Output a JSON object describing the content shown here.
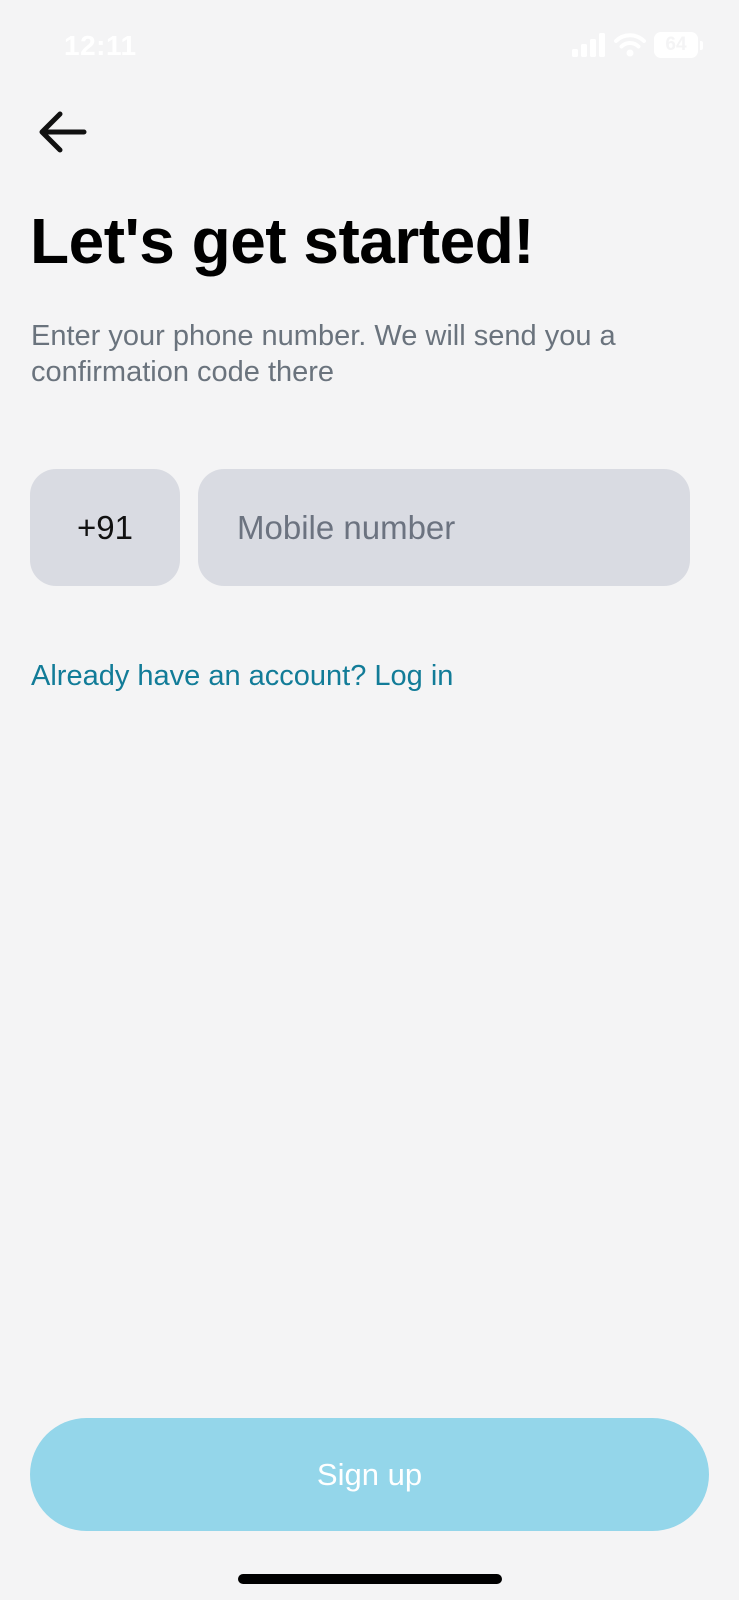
{
  "status_bar": {
    "time": "12:11",
    "battery_level": "64",
    "icons": [
      "cellular-signal-icon",
      "wifi-icon",
      "battery-icon"
    ]
  },
  "header": {
    "back_icon": "arrow-left-icon"
  },
  "main": {
    "title": "Let's get started!",
    "subtitle": "Enter your phone number. We will send you a confirmation code there",
    "country_code": "+91",
    "phone_value": "",
    "phone_placeholder": "Mobile number",
    "login_link": "Already have an account? Log in"
  },
  "footer": {
    "signup_label": "Sign up"
  },
  "colors": {
    "background": "#f4f4f5",
    "input_background": "#d9dbe2",
    "link": "#127c98",
    "button_disabled": "#94d6ea"
  }
}
